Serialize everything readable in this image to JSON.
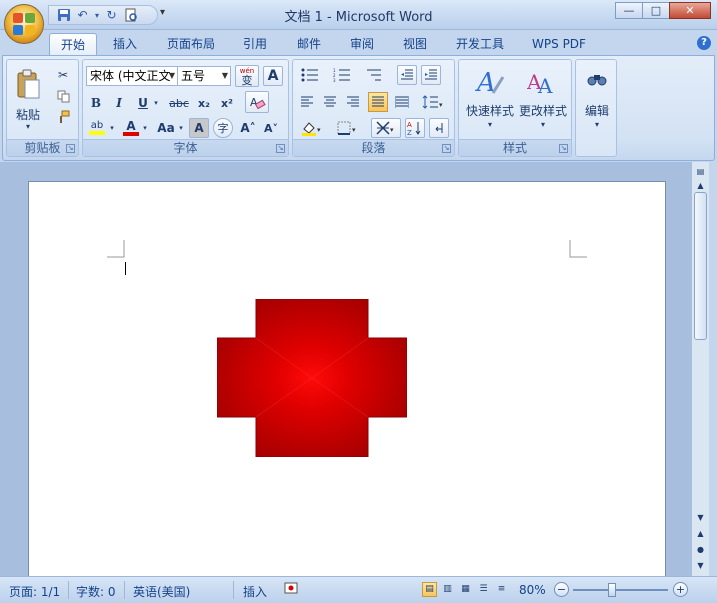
{
  "window": {
    "title": "文档 1 - Microsoft Word",
    "minimize_glyph": "—",
    "maximize_glyph": "□",
    "close_glyph": "✕"
  },
  "quick_access": {
    "icons": [
      "save-icon",
      "undo-icon",
      "redo-icon",
      "print-preview-icon"
    ],
    "caret": "▾"
  },
  "tabs": [
    {
      "label": "开始",
      "active": true
    },
    {
      "label": "插入"
    },
    {
      "label": "页面布局"
    },
    {
      "label": "引用"
    },
    {
      "label": "邮件"
    },
    {
      "label": "审阅"
    },
    {
      "label": "视图"
    },
    {
      "label": "开发工具"
    },
    {
      "label": "WPS PDF"
    }
  ],
  "ribbon": {
    "clipboard": {
      "label": "剪贴板",
      "paste_label": "粘贴",
      "paste_caret": "▾"
    },
    "font": {
      "label": "字体",
      "font_name": "宋体 (中文正文",
      "font_size": "五号",
      "bold": "B",
      "italic": "I",
      "underline": "U",
      "strikethrough": "abc",
      "subscript": "x₂",
      "superscript": "x²",
      "case": "Aa",
      "grow": "A˄",
      "shrink": "A˅",
      "char_border": "A",
      "char_shading": "A",
      "enclose": "字",
      "pinyin": "wén",
      "pinyin_char": "变",
      "font_color": "A",
      "highlight": "ab",
      "clear": "A"
    },
    "paragraph": {
      "label": "段落"
    },
    "styles": {
      "label": "样式",
      "quick_styles": "快速样式",
      "change_styles": "更改样式"
    },
    "editing": {
      "label": "编辑"
    }
  },
  "status": {
    "page": "页面: 1/1",
    "words": "字数: 0",
    "language": "英语(美国)",
    "insert_mode": "插入",
    "zoom": "80%"
  },
  "colors": {
    "accent": "#15428b",
    "shape_fill_center": "#ff0a0a",
    "shape_fill_edge": "#a80000",
    "highlight_yellow": "#ffff00",
    "font_red": "#e00000"
  }
}
